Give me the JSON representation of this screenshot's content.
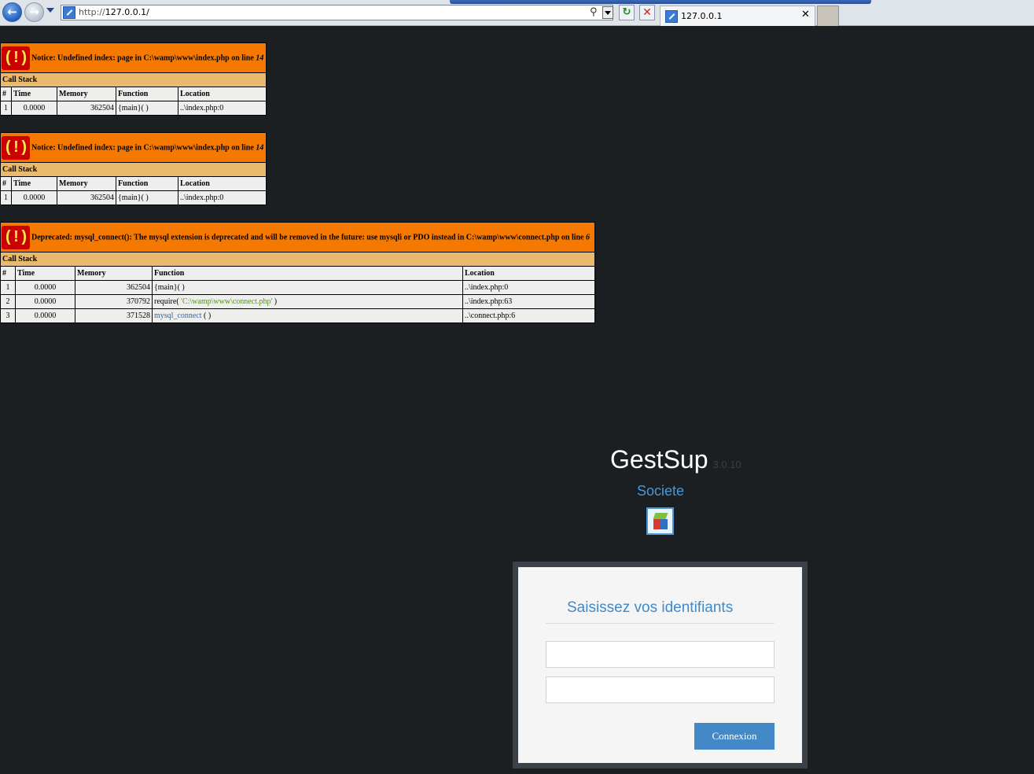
{
  "browser": {
    "address_url_prefix": "http://",
    "address_url_host": "127.0.0.1/",
    "tab_title": "127.0.0.1",
    "search_glyph": "⚲",
    "back_glyph": "←",
    "forward_glyph": "→",
    "refresh_glyph": "↻",
    "stop_glyph": "✕",
    "close_glyph": "✕"
  },
  "errors": [
    {
      "icon_text": "( ! )",
      "message": "Notice: Undefined index: page in C:\\wamp\\www\\index.php on line ",
      "line": "14",
      "call_stack_label": "Call Stack",
      "headers": [
        "#",
        "Time",
        "Memory",
        "Function",
        "Location"
      ],
      "rows": [
        {
          "n": "1",
          "time": "0.0000",
          "memory": "362504",
          "func": "{main}( )",
          "location": "..\\index.php:0"
        }
      ]
    },
    {
      "icon_text": "( ! )",
      "message": "Notice: Undefined index: page in C:\\wamp\\www\\index.php on line ",
      "line": "14",
      "call_stack_label": "Call Stack",
      "headers": [
        "#",
        "Time",
        "Memory",
        "Function",
        "Location"
      ],
      "rows": [
        {
          "n": "1",
          "time": "0.0000",
          "memory": "362504",
          "func": "{main}( )",
          "location": "..\\index.php:0"
        }
      ]
    },
    {
      "icon_text": "( ! )",
      "message": "Deprecated: mysql_connect(): The mysql extension is deprecated and will be removed in the future: use mysqli or PDO instead in C:\\wamp\\www\\connect.php on line ",
      "line": "6",
      "call_stack_label": "Call Stack",
      "headers": [
        "#",
        "Time",
        "Memory",
        "Function",
        "Location"
      ],
      "rows": [
        {
          "n": "1",
          "time": "0.0000",
          "memory": "362504",
          "func": "{main}( )",
          "location": "..\\index.php:0"
        },
        {
          "n": "2",
          "time": "0.0000",
          "memory": "370792",
          "func_prefix": "require( ",
          "func_arg": "'C:\\wamp\\www\\connect.php'",
          "func_suffix": " )",
          "location": "..\\index.php:63"
        },
        {
          "n": "3",
          "time": "0.0000",
          "memory": "371528",
          "func_link": "mysql_connect",
          "func_suffix": " ( )",
          "location": "..\\connect.php:6"
        }
      ]
    }
  ],
  "login": {
    "app_name": "GestSup",
    "app_version": "3.0.10",
    "company": "Societe",
    "title": "Saisissez vos identifiants",
    "username_value": "",
    "password_value": "",
    "submit_label": "Connexion"
  },
  "colors": {
    "background": "#1b1f21",
    "error_header": "#f57900",
    "call_stack": "#e9b96e",
    "accent": "#4389c8"
  }
}
